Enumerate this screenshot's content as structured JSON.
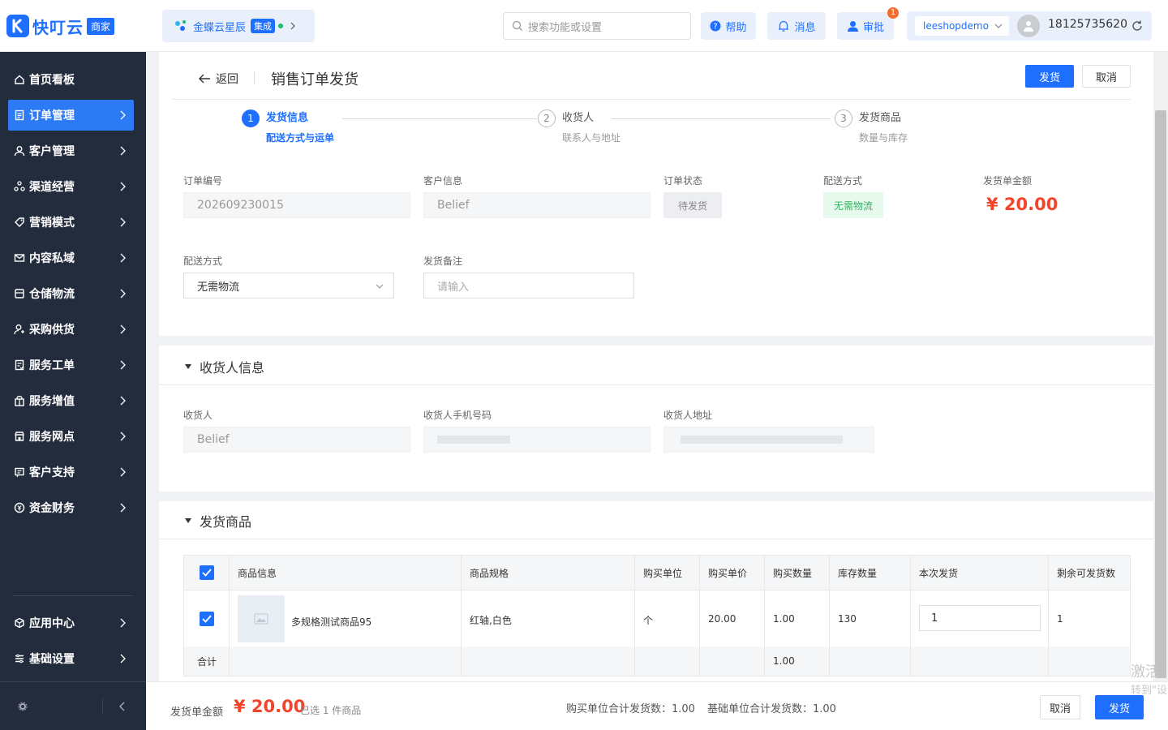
{
  "topbar": {
    "logo_text": "快叮云",
    "logo_badge": "商家",
    "integration_name": "金蝶云星辰",
    "integration_tag": "集成",
    "search_placeholder": "搜索功能或设置",
    "help_label": "帮助",
    "message_label": "消息",
    "approval_label": "审批",
    "approval_count": "1",
    "store_name": "leeshopdemo",
    "phone": "18125735620"
  },
  "sidebar": {
    "items": [
      {
        "label": "首页看板",
        "icon": "home-icon"
      },
      {
        "label": "订单管理",
        "icon": "order-icon"
      },
      {
        "label": "客户管理",
        "icon": "user-icon"
      },
      {
        "label": "渠道经营",
        "icon": "channel-icon"
      },
      {
        "label": "营销模式",
        "icon": "tag-icon"
      },
      {
        "label": "内容私域",
        "icon": "mail-icon"
      },
      {
        "label": "仓储物流",
        "icon": "warehouse-icon"
      },
      {
        "label": "采购供货",
        "icon": "purchase-icon"
      },
      {
        "label": "服务工单",
        "icon": "ticket-icon"
      },
      {
        "label": "服务增值",
        "icon": "gift-icon"
      },
      {
        "label": "服务网点",
        "icon": "store-icon"
      },
      {
        "label": "客户支持",
        "icon": "support-icon"
      },
      {
        "label": "资金财务",
        "icon": "finance-icon"
      }
    ],
    "bottom_items": [
      {
        "label": "应用中心",
        "icon": "cube-icon"
      },
      {
        "label": "基础设置",
        "icon": "settings-list-icon"
      }
    ]
  },
  "header": {
    "back_label": "返回",
    "title": "销售订单发货",
    "ship_button": "发货",
    "cancel_button": "取消"
  },
  "steps": [
    {
      "num": "1",
      "title": "发货信息",
      "subtitle": "配送方式与运单"
    },
    {
      "num": "2",
      "title": "收货人",
      "subtitle": "联系人与地址"
    },
    {
      "num": "3",
      "title": "发货商品",
      "subtitle": "数量与库存"
    }
  ],
  "order_info": {
    "order_no_label": "订单编号",
    "order_no": "202609230015",
    "customer_label": "客户信息",
    "customer": "Belief",
    "status_label": "订单状态",
    "status": "待发货",
    "delivery_label": "配送方式",
    "delivery": "无需物流",
    "amount_label": "发货单金额",
    "amount": "¥ 20.00"
  },
  "form": {
    "delivery_method_label": "配送方式",
    "delivery_method_value": "无需物流",
    "remark_label": "发货备注",
    "remark_placeholder": "请输入"
  },
  "receiver": {
    "section_title": "收货人信息",
    "name_label": "收货人",
    "name": "Belief",
    "phone_label": "收货人手机号码",
    "address_label": "收货人地址"
  },
  "goods": {
    "section_title": "发货商品",
    "columns": [
      "商品信息",
      "商品规格",
      "购买单位",
      "购买单价",
      "购买数量",
      "库存数量",
      "本次发货",
      "剩余可发货数"
    ],
    "row": {
      "name": "多规格测试商品95",
      "spec": "红轴,白色",
      "unit": "个",
      "price": "20.00",
      "qty": "1.00",
      "stock": "130",
      "ship_qty": "1",
      "remaining": "1"
    },
    "total_label": "合计",
    "total_qty": "1.00"
  },
  "footer": {
    "amount_label": "发货单金额",
    "amount": "¥ 20.00",
    "selected": "已选 1 件商品",
    "purchase_unit_total": "购买单位合计发货数：1.00",
    "base_unit_total": "基础单位合计发货数：1.00",
    "cancel_button": "取消",
    "ship_button": "发货"
  },
  "watermark": {
    "line1": "激活",
    "line2": "转到\"设"
  }
}
